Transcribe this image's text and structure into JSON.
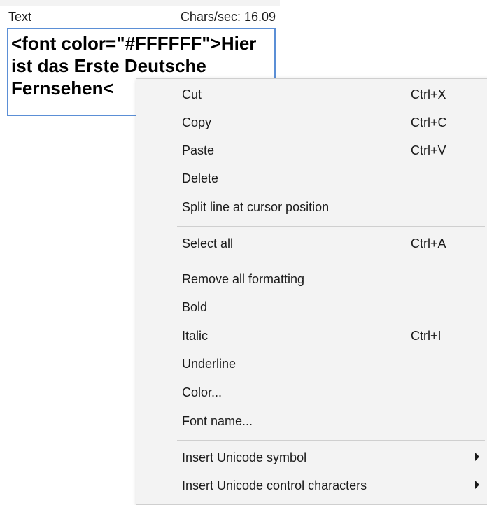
{
  "editor": {
    "header_left": "Text",
    "header_right": "Chars/sec: 16.09",
    "content": "<font color=\"#FFFFFF\">Hier ist das Erste Deutsche Fernsehen<"
  },
  "context_menu": {
    "items": [
      {
        "label": "Cut",
        "shortcut": "Ctrl+X"
      },
      {
        "label": "Copy",
        "shortcut": "Ctrl+C"
      },
      {
        "label": "Paste",
        "shortcut": "Ctrl+V"
      },
      {
        "label": "Delete",
        "shortcut": ""
      },
      {
        "label": "Split line at cursor position",
        "shortcut": ""
      },
      {
        "label": "Select all",
        "shortcut": "Ctrl+A"
      },
      {
        "label": "Remove all formatting",
        "shortcut": ""
      },
      {
        "label": "Bold",
        "shortcut": ""
      },
      {
        "label": "Italic",
        "shortcut": "Ctrl+I"
      },
      {
        "label": "Underline",
        "shortcut": ""
      },
      {
        "label": "Color...",
        "shortcut": ""
      },
      {
        "label": "Font name...",
        "shortcut": ""
      },
      {
        "label": "Insert Unicode symbol",
        "shortcut": "",
        "submenu": true
      },
      {
        "label": "Insert Unicode control characters",
        "shortcut": "",
        "submenu": true
      }
    ]
  },
  "colors": {
    "menu_background": "#f3f3f3",
    "editor_border": "#5b8fd6",
    "text": "#1a1a1a"
  }
}
